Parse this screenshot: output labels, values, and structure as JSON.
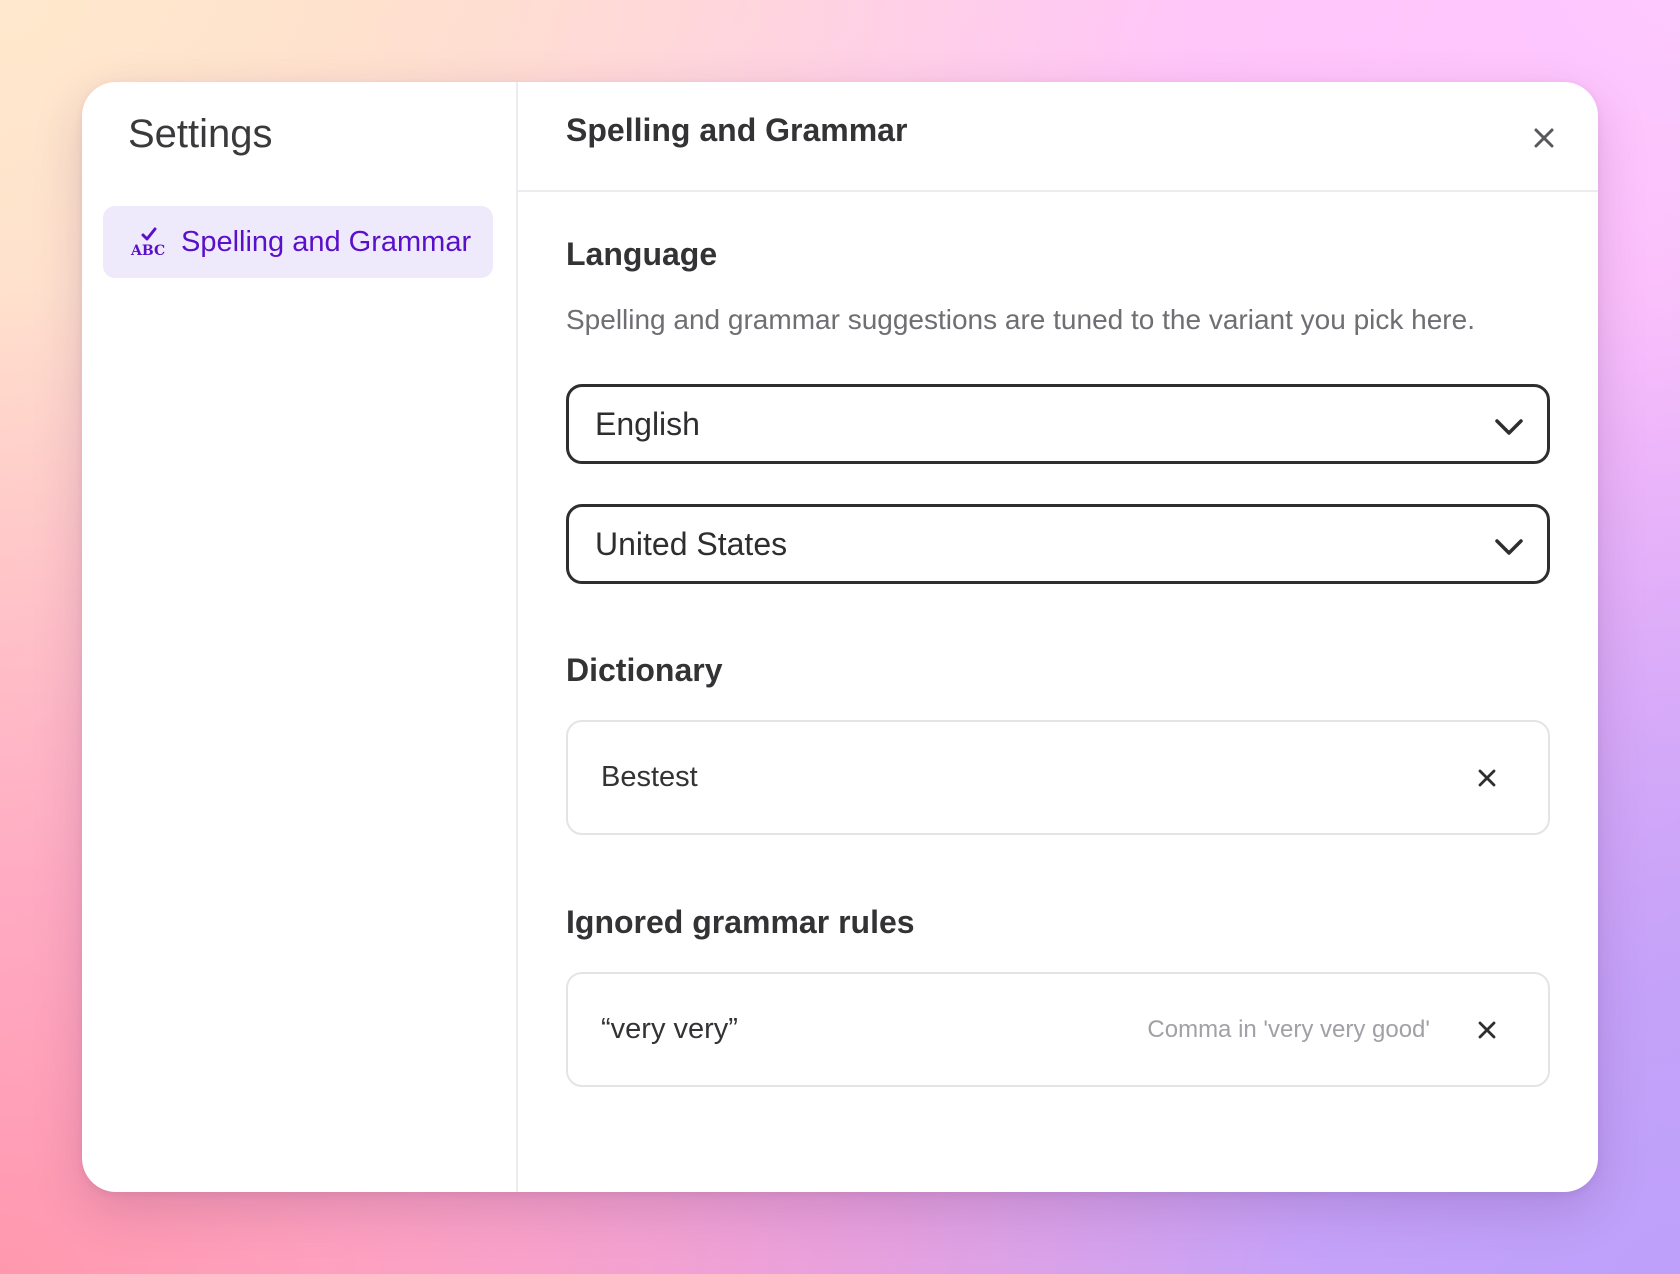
{
  "sidebar": {
    "title": "Settings",
    "items": [
      {
        "label": "Spelling and Grammar",
        "icon": "spellcheck-abc-icon",
        "active": true
      }
    ]
  },
  "header": {
    "title": "Spelling and Grammar",
    "close_icon": "close-icon"
  },
  "language": {
    "title": "Language",
    "description": "Spelling and grammar suggestions are tuned to the variant you pick here.",
    "language_select": {
      "value": "English"
    },
    "region_select": {
      "value": "United States"
    }
  },
  "dictionary": {
    "title": "Dictionary",
    "entries": [
      {
        "word": "Bestest"
      }
    ]
  },
  "ignored_rules": {
    "title": "Ignored grammar rules",
    "entries": [
      {
        "phrase": "“very very”",
        "rule": "Comma in 'very very good'"
      }
    ]
  },
  "colors": {
    "accent": "#5a10c8",
    "accent_bg": "#efeafb",
    "text": "#333336",
    "muted": "#6e6e73"
  }
}
